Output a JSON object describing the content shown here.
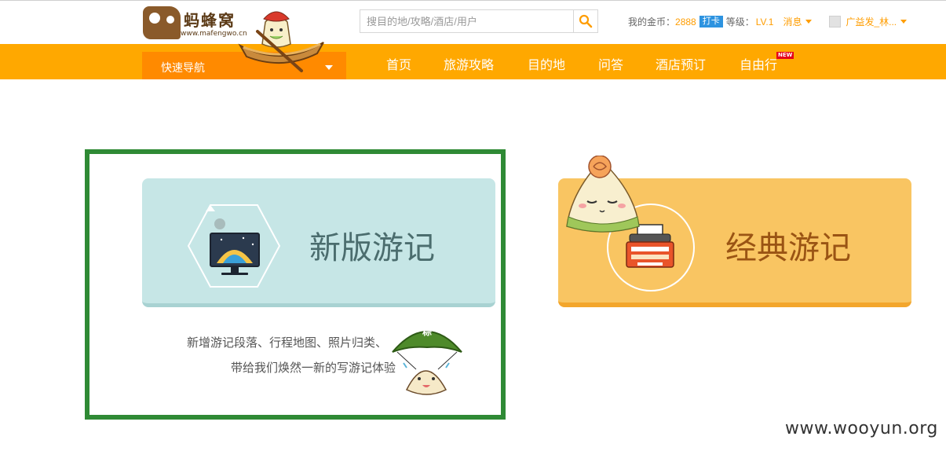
{
  "header": {
    "logo_text": "蚂蜂窝",
    "logo_url": "www.mafengwo.cn",
    "search_placeholder": "搜目的地/攻略/酒店/用户",
    "gold_label": "我的金币：",
    "gold_value": "2888",
    "checkin_label": "打卡",
    "level_label": "等级：",
    "level_value": "LV.1",
    "messages_label": "消息",
    "username": "广益发_林..."
  },
  "nav": {
    "quick_nav_label": "快速导航",
    "items": [
      "首页",
      "旅游攻略",
      "目的地",
      "问答",
      "酒店预订",
      "自由行"
    ],
    "new_badge": "NEW"
  },
  "cards": {
    "new_title": "新版游记",
    "new_desc_line1": "新增游记段落、行程地图、照片归类、",
    "new_desc_line2": "带给我们焕然一新的写游记体验",
    "classic_title": "经典游记",
    "mascot_helmet_text": "粽"
  },
  "watermark": "www.wooyun.org",
  "colors": {
    "nav_orange": "#ffa800",
    "quick_nav_orange": "#ff8a00",
    "card_new_bg": "#c6e6e6",
    "card_classic_bg": "#f9c562",
    "selected_frame": "#2f8a35"
  },
  "icons": [
    "search-icon",
    "monitor-icon",
    "typewriter-icon",
    "caret-down-icon"
  ]
}
